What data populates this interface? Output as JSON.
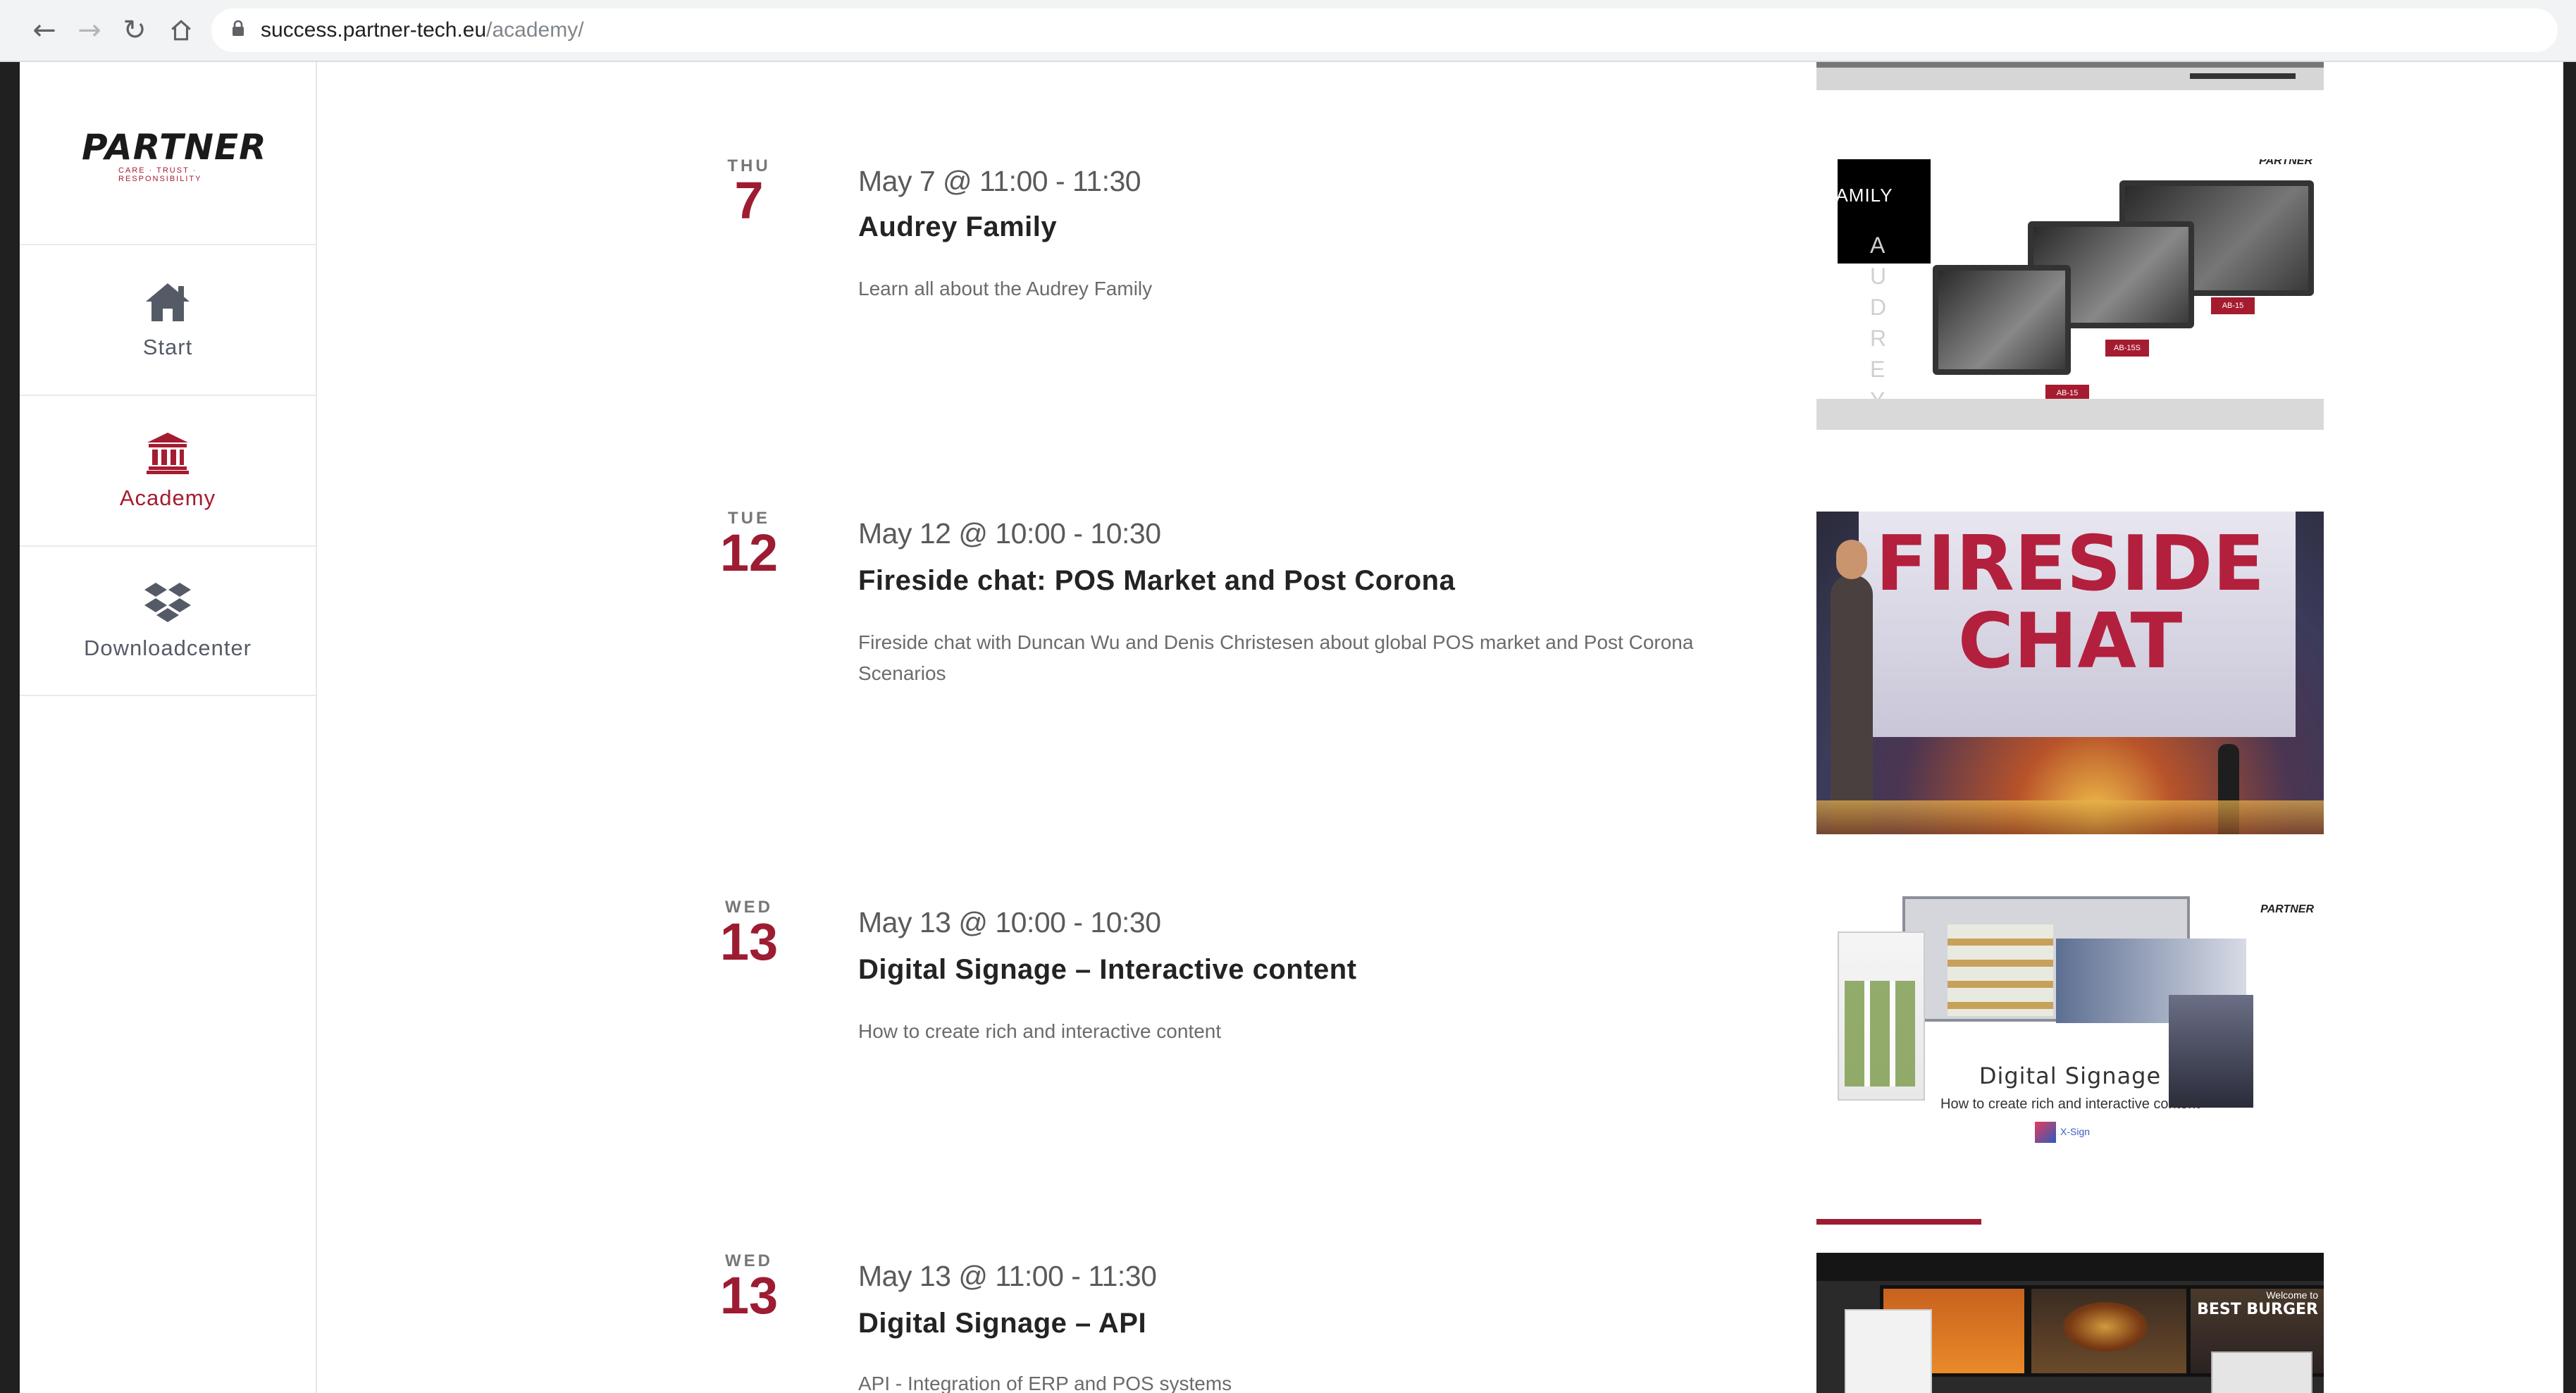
{
  "browser": {
    "url_host": "success.partner-tech.eu",
    "url_path": "/academy/"
  },
  "sidebar": {
    "logo": "PARTNER",
    "logo_tagline": "CARE · TRUST · RESPONSIBILITY",
    "items": [
      {
        "label": "Start",
        "icon": "home-icon",
        "active": false
      },
      {
        "label": "Academy",
        "icon": "bank-icon",
        "active": true
      },
      {
        "label": "Downloadcenter",
        "icon": "dropbox-icon",
        "active": false
      }
    ]
  },
  "events": [
    {
      "weekday": "THU",
      "day": "7",
      "time": "May 7 @ 11:00 - 11:30",
      "title": "Audrey Family",
      "description": "Learn all about the Audrey Family",
      "image": {
        "word": "FAMILY",
        "letters": "AUDREY",
        "brand": "PARTNER",
        "tags": [
          "AB-15",
          "AB-15S",
          "AB-15"
        ]
      }
    },
    {
      "weekday": "TUE",
      "day": "12",
      "time": "May 12 @ 10:00 - 10:30",
      "title": "Fireside chat: POS Market and Post Corona",
      "description": "Fireside chat with Duncan Wu and Denis Christesen about global POS market and Post Corona Scenarios",
      "image": {
        "line1": "FIRESIDE",
        "line2": "CHAT"
      }
    },
    {
      "weekday": "WED",
      "day": "13",
      "time": "May 13 @ 10:00 - 10:30",
      "title": "Digital Signage – Interactive content",
      "description": "How to create rich and interactive content",
      "image": {
        "brand": "PARTNER",
        "caption": "Digital Signage",
        "subcaption": "How to create rich and interactive content",
        "logo_text": "X-Sign"
      }
    },
    {
      "weekday": "WED",
      "day": "13",
      "time": "May 13 @ 11:00 - 11:30",
      "title": "Digital Signage – API",
      "description": "API - Integration of ERP and POS systems",
      "image": {
        "banner": "BEST BURGER",
        "banner_top": "Welcome to"
      }
    }
  ],
  "colors": {
    "accent": "#9d1c32",
    "text": "#232323",
    "muted": "#6b6b6b"
  }
}
